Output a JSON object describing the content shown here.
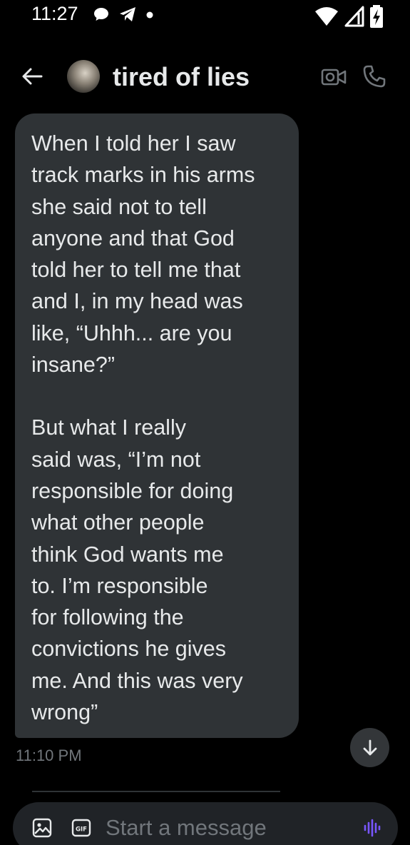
{
  "status_bar": {
    "time": "11:27"
  },
  "header": {
    "title": "tired of lies"
  },
  "message": {
    "paragraph_1": "When I told her I saw\ntrack marks in his arms\nshe said not to tell\nanyone and that God\ntold her to tell me that\nand I, in my head was\nlike, “Uhhh... are you\ninsane?”",
    "paragraph_2": "But what I really\nsaid was, “I’m not\nresponsible for doing\nwhat other people\nthink God wants me\nto. I’m responsible\nfor following the\nconvictions he gives\nme. And this was very\nwrong”",
    "timestamp": "11:10 PM"
  },
  "composer": {
    "placeholder": "Start a message"
  },
  "colors": {
    "background": "#000000",
    "bubble": "#2f3336",
    "text": "#e7e9ea",
    "muted": "#71767b",
    "accent": "#7856ff"
  },
  "icons": {
    "back": "arrow-left-icon",
    "video": "video-camera-icon",
    "phone": "phone-icon",
    "scroll": "arrow-down-icon",
    "photo": "image-icon",
    "gif": "gif-icon",
    "voice": "voice-wave-icon"
  }
}
